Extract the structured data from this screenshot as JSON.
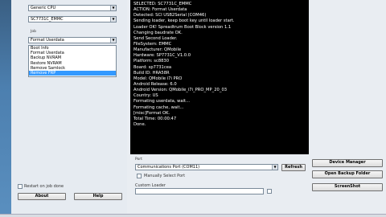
{
  "left": {
    "manufacturer_select": "Generic CPU",
    "model_select": "SC7731C_EMMC",
    "job_label": "Job",
    "job_select": "Format Userdata",
    "job_options": [
      "Boot Info",
      "Format Userdata",
      "Backup NVRAM",
      "Restore NVRAM",
      "Remove Samlock",
      "Remove FRP"
    ],
    "selected_index": 5,
    "restart_label": "Restart on job done",
    "about_label": "About",
    "help_label": "Help"
  },
  "log": {
    "lines": [
      "SELECTED: SC7731C_EMMC",
      "ACTION: Format Userdata",
      "Detected: SCI USB2Serial (COM46)",
      "Sending loader, keep boot key until loader start.",
      "Loader OK! Spreadtrum Boot Block version 1.1",
      "Changing baudrate OK.",
      "Send Second Loader.",
      "FileSystem: EMMC",
      "Manufacturer: QMobile",
      "Hardware: SP7731C_V1.0.0",
      "Platform: sc8830",
      "Board: sp7731cea",
      "Build ID: HRA58R",
      "Model: QMobile i7i PRO",
      "Android Release: 6.0",
      "Android Version: QMobile_i7i_PRO_MP_20_03",
      "Country: US",
      "Formating userdata, wait...",
      "Formating cache, wait...",
      "[misc]Format OK.",
      "Total Time: 00:00:47",
      "Done."
    ]
  },
  "port": {
    "group_label": "Port",
    "port_select": "Communications Port (COM11)",
    "refresh_label": "Refresh",
    "manual_label": "Manually Select Port",
    "custom_loader_label": "Custom Loader"
  },
  "actions": {
    "device_manager": "Device Manager",
    "open_backup": "Open Backup Folder",
    "screenshot": "ScreenShot"
  }
}
